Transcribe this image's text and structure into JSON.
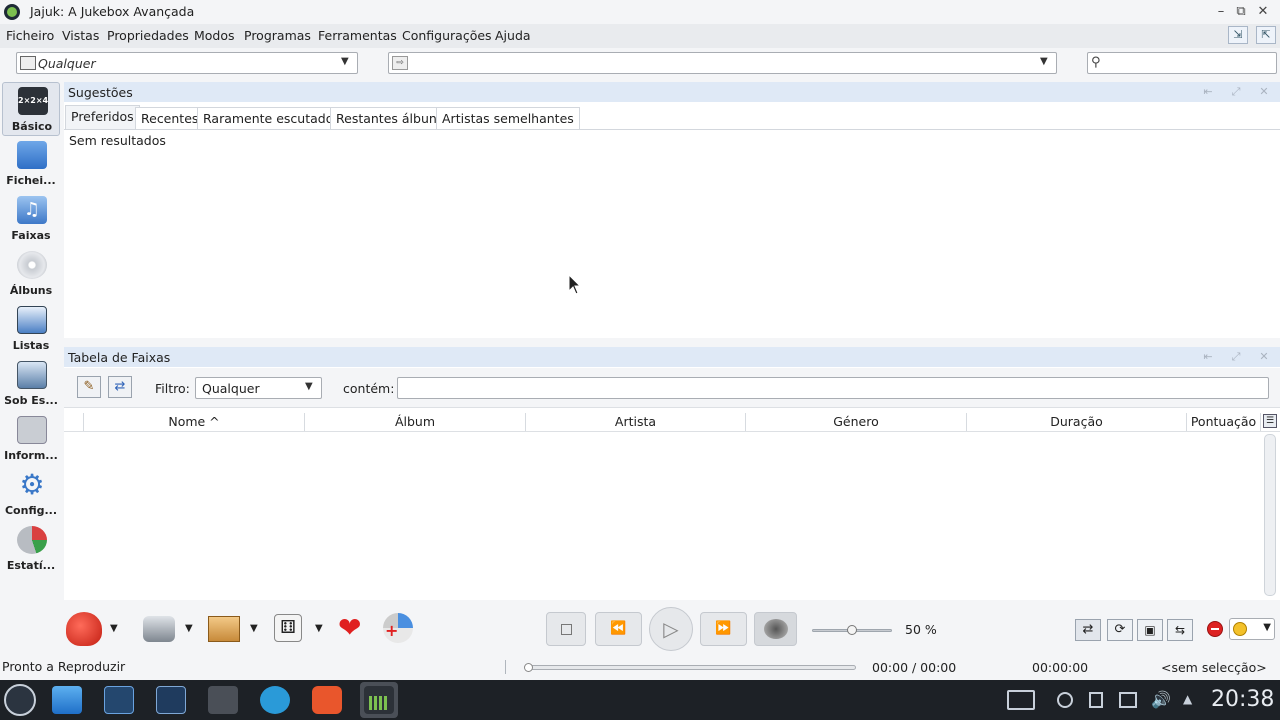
{
  "window": {
    "title": "Jajuk: A Jukebox Avançada"
  },
  "menu": {
    "items": [
      "Ficheiro",
      "Vistas",
      "Propriedades",
      "Modos",
      "Programas",
      "Ferramentas",
      "Configurações",
      "Ajuda"
    ]
  },
  "toolbar": {
    "ambience_value": "Qualquer",
    "search_placeholder": ""
  },
  "sidebar": {
    "items": [
      {
        "label": "Básico",
        "icon": "grid-layout-icon"
      },
      {
        "label": "Fichei...",
        "icon": "folder-icon"
      },
      {
        "label": "Faixas",
        "icon": "music-note-icon"
      },
      {
        "label": "Álbuns",
        "icon": "cd-icon"
      },
      {
        "label": "Listas",
        "icon": "playlist-icon"
      },
      {
        "label": "Sob Es...",
        "icon": "monitor-icon"
      },
      {
        "label": "Inform...",
        "icon": "keyboard-icon"
      },
      {
        "label": "Config...",
        "icon": "gear-icon"
      },
      {
        "label": "Estatí...",
        "icon": "pie-chart-icon"
      }
    ]
  },
  "suggestions_panel": {
    "title": "Sugestões",
    "tabs": [
      "Preferidos",
      "Recentes",
      "Raramente escutados",
      "Restantes álbuns",
      "Artistas semelhantes"
    ],
    "empty_text": "Sem resultados"
  },
  "tracks_panel": {
    "title": "Tabela de Faixas",
    "filter_label": "Filtro:",
    "filter_value": "Qualquer",
    "contains_label": "contém:",
    "contains_value": "",
    "columns": [
      "Nome ^",
      "Álbum",
      "Artista",
      "Género",
      "Duração",
      "Pontuação"
    ]
  },
  "player": {
    "volume_text": "50 %",
    "volume": 0.5,
    "position": 0
  },
  "status": {
    "left_text": "Pronto a Reproduzir",
    "time_text": "00:00 / 00:00",
    "total_time": "00:00:00",
    "selection_text": "<sem selecção>"
  },
  "taskbar": {
    "clock": "20:38"
  },
  "colors": {
    "panel_header": "#dfe9f6",
    "taskbar": "#1d2126",
    "accent": "#3b7fd9"
  }
}
